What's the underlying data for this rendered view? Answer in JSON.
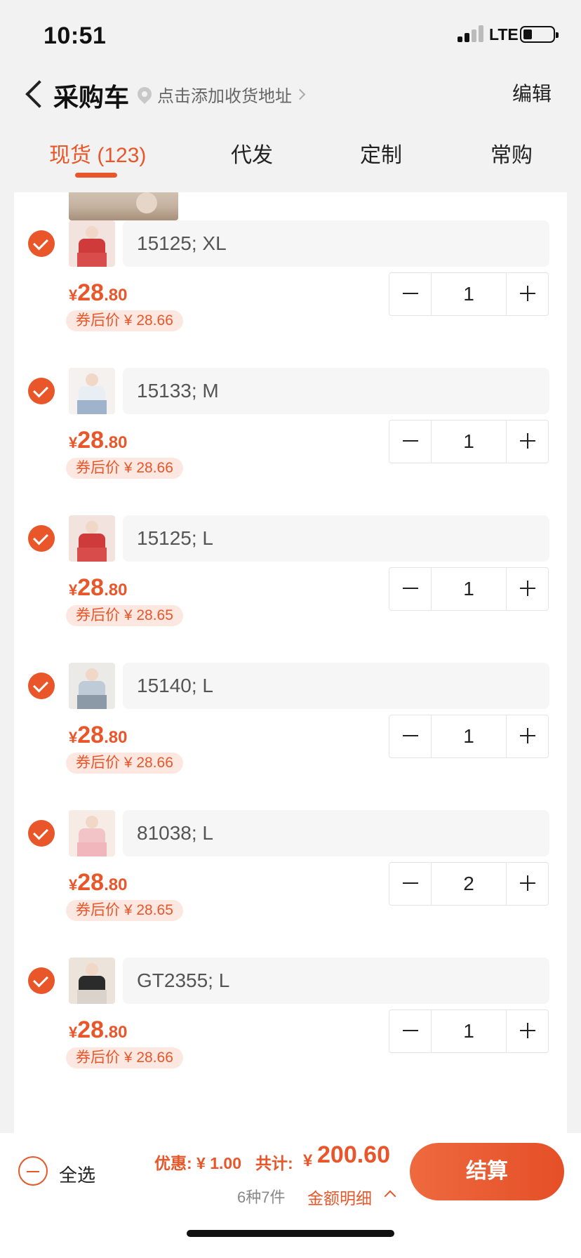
{
  "status_bar": {
    "time": "10:51",
    "network": "LTE"
  },
  "header": {
    "title": "采购车",
    "address_prompt": "点击添加收货地址",
    "edit_label": "编辑"
  },
  "tabs": [
    {
      "label": "现货 (123)",
      "active": true
    },
    {
      "label": "代发",
      "active": false
    },
    {
      "label": "定制",
      "active": false
    },
    {
      "label": "常购",
      "active": false
    }
  ],
  "items": [
    {
      "spec": "15125; XL",
      "price_symbol": "¥",
      "price_int": "28",
      "price_dec": ".80",
      "coupon_price": "券后价 ¥ 28.66",
      "quantity": "1",
      "thumb": {
        "top": "#cf3a3a",
        "legs": "#d94c4c",
        "bg": "#f3e3de"
      }
    },
    {
      "spec": "15133; M",
      "price_symbol": "¥",
      "price_int": "28",
      "price_dec": ".80",
      "coupon_price": "券后价 ¥ 28.66",
      "quantity": "1",
      "thumb": {
        "top": "#e9eef5",
        "legs": "#9fb4cc",
        "bg": "#f4f1ee"
      }
    },
    {
      "spec": "15125; L",
      "price_symbol": "¥",
      "price_int": "28",
      "price_dec": ".80",
      "coupon_price": "券后价 ¥ 28.65",
      "quantity": "1",
      "thumb": {
        "top": "#cf3a3a",
        "legs": "#d94c4c",
        "bg": "#f3e3de"
      }
    },
    {
      "spec": "15140; L",
      "price_symbol": "¥",
      "price_int": "28",
      "price_dec": ".80",
      "coupon_price": "券后价 ¥ 28.66",
      "quantity": "1",
      "thumb": {
        "top": "#bfcbd6",
        "legs": "#8c9aa8",
        "bg": "#eceae6"
      }
    },
    {
      "spec": "81038; L",
      "price_symbol": "¥",
      "price_int": "28",
      "price_dec": ".80",
      "coupon_price": "券后价 ¥ 28.65",
      "quantity": "2",
      "thumb": {
        "top": "#f2c4c8",
        "legs": "#f0b6bb",
        "bg": "#f7ebe6"
      }
    },
    {
      "spec": "GT2355; L",
      "price_symbol": "¥",
      "price_int": "28",
      "price_dec": ".80",
      "coupon_price": "券后价 ¥ 28.66",
      "quantity": "1",
      "thumb": {
        "top": "#2b2b2b",
        "legs": "#d9d3cc",
        "bg": "#ece4da"
      }
    }
  ],
  "bottom_bar": {
    "select_all_label": "全选",
    "discount": "优惠: ¥ 1.00",
    "total_label": "共计:",
    "total_symbol": "¥",
    "total_value": "200.60",
    "count_text": "6种7件",
    "detail_label": "金额明细",
    "checkout_label": "结算"
  },
  "colors": {
    "accent": "#e8562a",
    "coupon_bg": "#fde8e1"
  }
}
